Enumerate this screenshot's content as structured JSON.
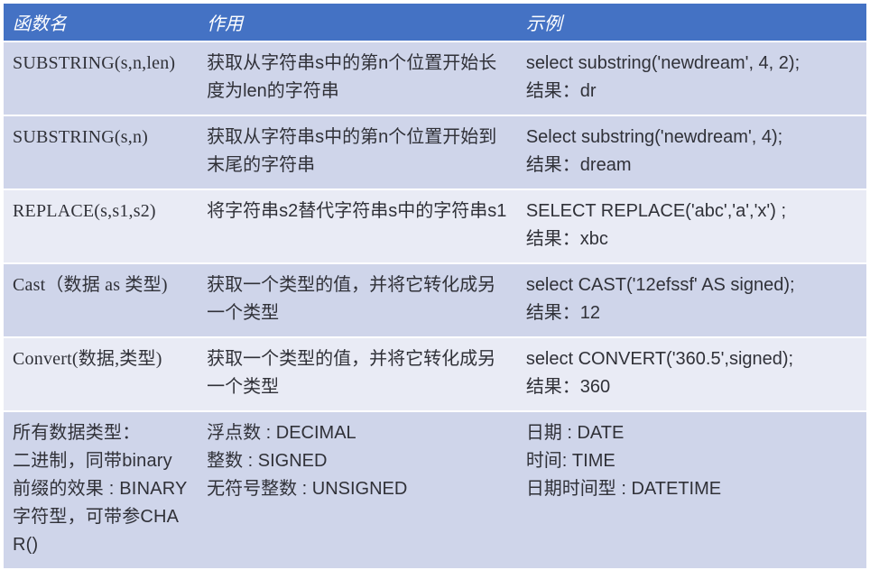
{
  "headers": {
    "c1": "函数名",
    "c2": "作用",
    "c3": "示例"
  },
  "rows": [
    {
      "c1": "SUBSTRING(s,n,len)",
      "c2": "获取从字符串s中的第n个位置开始长度为len的字符串",
      "c3_l1": "select substring('newdream', 4, 2);",
      "c3_l2": "结果：dr"
    },
    {
      "c1": "SUBSTRING(s,n)",
      "c2": "获取从字符串s中的第n个位置开始到末尾的字符串",
      "c3_l1": "Select substring('newdream', 4);",
      "c3_l2": "结果：dream"
    },
    {
      "c1": "REPLACE(s,s1,s2)",
      "c2": "将字符串s2替代字符串s中的字符串s1",
      "c3_l1": "SELECT REPLACE('abc','a','x') ;",
      "c3_l2": "结果：xbc"
    },
    {
      "c1": "Cast（数据 as 类型)",
      "c2": "获取一个类型的值，并将它转化成另一个类型",
      "c3_l1": "select  CAST('12efssf' AS signed);",
      "c3_l2": "结果：12"
    },
    {
      "c1": "Convert(数据,类型)",
      "c2": "获取一个类型的值，并将它转化成另一个类型",
      "c3_l1": "select CONVERT('360.5',signed);",
      "c3_l2": "结果：360"
    },
    {
      "c1": "所有数据类型：\n二进制，同带binary前缀的效果 : BINARY\n 字符型，可带参CHAR()",
      "c2_l1": "浮点数 : DECIMAL",
      "c2_l2": "整数 : SIGNED",
      "c2_l3": "无符号整数 : UNSIGNED",
      "c3_l1": "日期 : DATE",
      "c3_l2": "时间: TIME",
      "c3_l3": "日期时间型 : DATETIME"
    }
  ]
}
